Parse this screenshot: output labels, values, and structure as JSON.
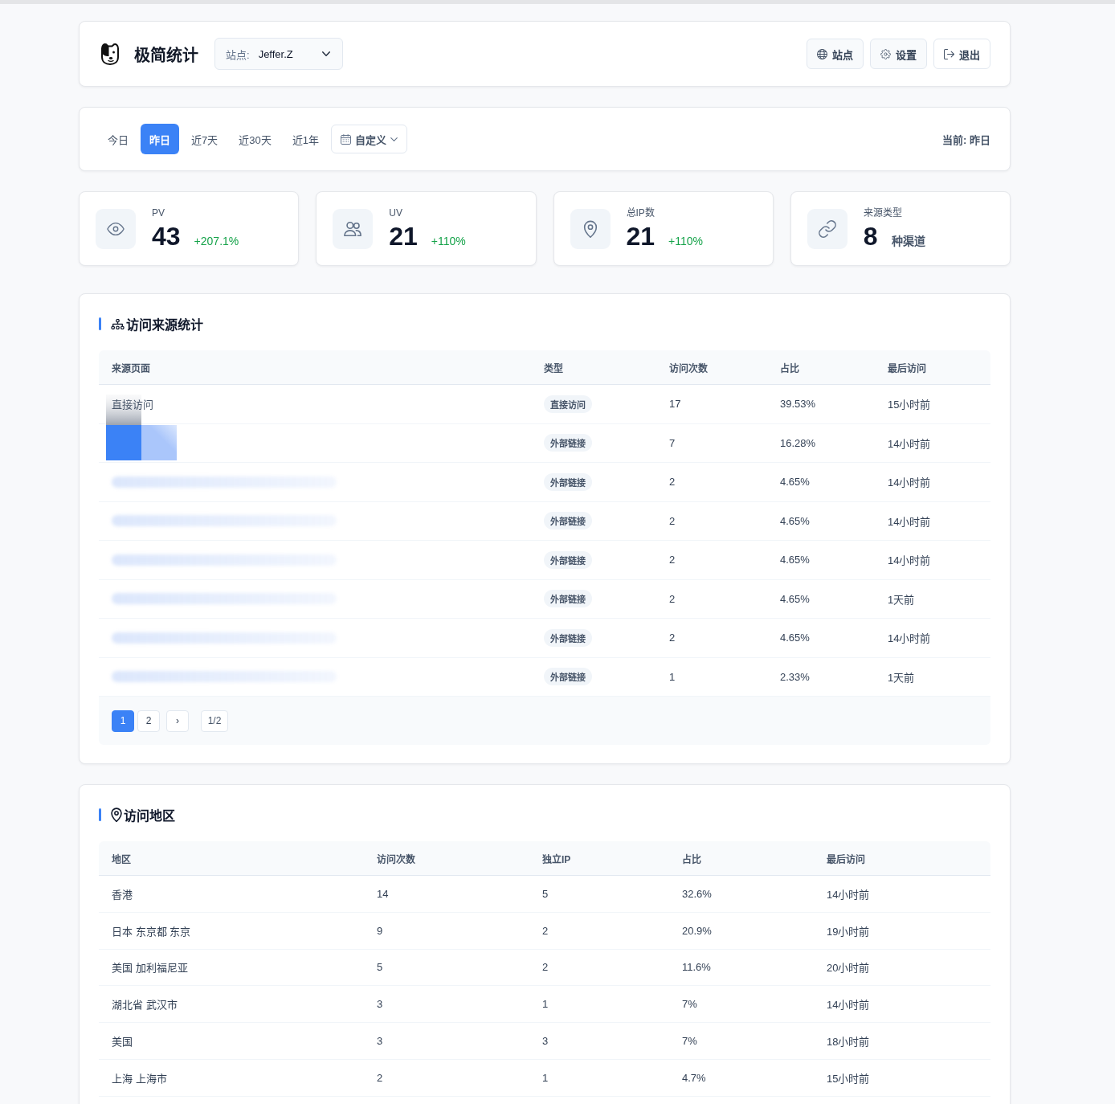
{
  "header": {
    "title": "极简统计",
    "site_select": {
      "label": "站点:",
      "value": "Jeffer.Z"
    },
    "buttons": [
      {
        "label": "站点",
        "kind": "filled"
      },
      {
        "label": "设置",
        "kind": "filled"
      },
      {
        "label": "退出",
        "kind": "outline"
      }
    ]
  },
  "filter_bar": {
    "tabs": [
      {
        "label": "今日",
        "selected": false
      },
      {
        "label": "昨日",
        "selected": true
      },
      {
        "label": "近7天",
        "selected": false
      },
      {
        "label": "近30天",
        "selected": false
      },
      {
        "label": "近1年",
        "selected": false
      }
    ],
    "custom_range": {
      "label": "自定义"
    },
    "current": "当前: 昨日"
  },
  "stats": [
    {
      "kind": "growth",
      "label": "PV",
      "value": "43",
      "note": "+207.1%"
    },
    {
      "kind": "growth",
      "label": "UV",
      "value": "21",
      "note": "+110%"
    },
    {
      "kind": "growth",
      "label": "总IP数",
      "value": "21",
      "note": "+110%"
    },
    {
      "kind": "unit",
      "label": "来源类型",
      "value": "8",
      "note": "种渠道"
    }
  ],
  "sources": {
    "title": "访问来源统计",
    "columns": [
      "来源页面",
      "类型",
      "访问次数",
      "占比",
      "最后访问"
    ],
    "rows": [
      {
        "source": {
          "kind": "text",
          "text": "直接访问"
        },
        "type": "直接访问",
        "visits": "17",
        "share": "39.53%",
        "last_visit": "15小时前"
      },
      {
        "source": {
          "kind": "mosaic"
        },
        "type": "外部链接",
        "visits": "7",
        "share": "16.28%",
        "last_visit": "14小时前"
      },
      {
        "source": {
          "kind": "blurred"
        },
        "type": "外部链接",
        "visits": "2",
        "share": "4.65%",
        "last_visit": "14小时前"
      },
      {
        "source": {
          "kind": "blurred"
        },
        "type": "外部链接",
        "visits": "2",
        "share": "4.65%",
        "last_visit": "14小时前"
      },
      {
        "source": {
          "kind": "blurred"
        },
        "type": "外部链接",
        "visits": "2",
        "share": "4.65%",
        "last_visit": "14小时前"
      },
      {
        "source": {
          "kind": "blurred"
        },
        "type": "外部链接",
        "visits": "2",
        "share": "4.65%",
        "last_visit": "1天前"
      },
      {
        "source": {
          "kind": "blurred"
        },
        "type": "外部链接",
        "visits": "2",
        "share": "4.65%",
        "last_visit": "14小时前"
      },
      {
        "source": {
          "kind": "blurred"
        },
        "type": "外部链接",
        "visits": "1",
        "share": "2.33%",
        "last_visit": "1天前"
      }
    ],
    "pagination": {
      "pages": [
        {
          "label": "1",
          "selected": true
        },
        {
          "label": "2",
          "selected": false
        }
      ],
      "next": "›",
      "summary": "1/2"
    }
  },
  "regions": {
    "title": "访问地区",
    "columns": [
      "地区",
      "访问次数",
      "独立IP",
      "占比",
      "最后访问"
    ],
    "rows": [
      {
        "region": "香港",
        "visits": "14",
        "unique_ip": "5",
        "share": "32.6%",
        "last_visit": "14小时前"
      },
      {
        "region": "日本 东京都 东京",
        "visits": "9",
        "unique_ip": "2",
        "share": "20.9%",
        "last_visit": "19小时前"
      },
      {
        "region": "美国 加利福尼亚",
        "visits": "5",
        "unique_ip": "2",
        "share": "11.6%",
        "last_visit": "20小时前"
      },
      {
        "region": "湖北省 武汉市",
        "visits": "3",
        "unique_ip": "1",
        "share": "7%",
        "last_visit": "14小时前"
      },
      {
        "region": "美国",
        "visits": "3",
        "unique_ip": "3",
        "share": "7%",
        "last_visit": "18小时前"
      },
      {
        "region": "上海 上海市",
        "visits": "2",
        "unique_ip": "1",
        "share": "4.7%",
        "last_visit": "15小时前"
      }
    ]
  }
}
